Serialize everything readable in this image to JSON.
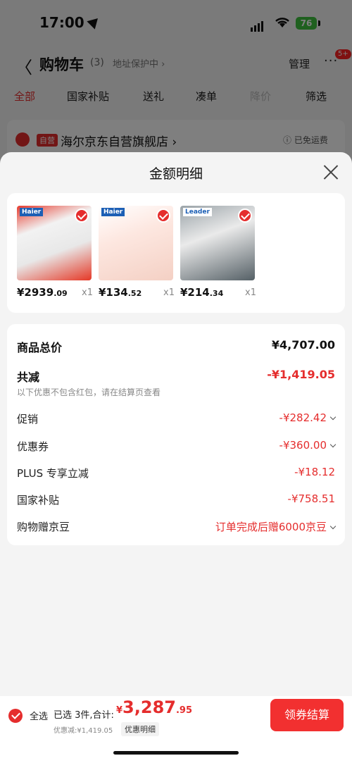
{
  "status_bar": {
    "time": "17:00",
    "battery": "76"
  },
  "top_bar": {
    "back": "〈",
    "title": "购物车",
    "count": "(3)",
    "address_protect": "地址保护中 ›",
    "manage": "管理",
    "more": "···",
    "more_badge": "5+"
  },
  "tabs": [
    "全部",
    "国家补贴",
    "送礼",
    "凑单",
    "降价",
    "筛选"
  ],
  "shop": {
    "tag": "自营",
    "name": "海尔京东自营旗舰店 ›",
    "free_shipping": "ⓘ 已免运费"
  },
  "sheet": {
    "title": "金额明细",
    "products": [
      {
        "brand": "Haier",
        "price_int": "¥2939",
        "price_dec": ".09",
        "qty": "x1"
      },
      {
        "brand": "Haier",
        "price_int": "¥134",
        "price_dec": ".52",
        "qty": "x1"
      },
      {
        "brand": "Leader",
        "price_int": "¥214",
        "price_dec": ".34",
        "qty": "x1"
      }
    ],
    "summary": {
      "total_label": "商品总价",
      "total_value": "¥4,707.00",
      "reduce_label": "共减",
      "reduce_value": "-¥1,419.05",
      "reduce_note": "以下优惠不包含红包，请在结算页查看",
      "items": [
        {
          "label": "促销",
          "value": "-¥282.42",
          "chevron": true
        },
        {
          "label": "优惠券",
          "value": "-¥360.00",
          "chevron": true
        },
        {
          "label": "PLUS 专享立减",
          "value": "-¥18.12",
          "chevron": false
        },
        {
          "label": "国家补贴",
          "value": "-¥758.51",
          "chevron": false
        },
        {
          "label": "购物赠京豆",
          "value": "订单完成后赠6000京豆",
          "chevron": true
        }
      ]
    }
  },
  "bottom_bar": {
    "select_all": "全选",
    "selected": "已选 3件,合计:",
    "total_cur": "¥",
    "total_int": "3,287",
    "total_dec": ".95",
    "discount": "优惠减:¥1,419.05",
    "detail_tag": "优惠明细",
    "checkout": "领券结算"
  },
  "colors": {
    "accent": "#e52d2d",
    "checkout_bg": "#f23030"
  }
}
